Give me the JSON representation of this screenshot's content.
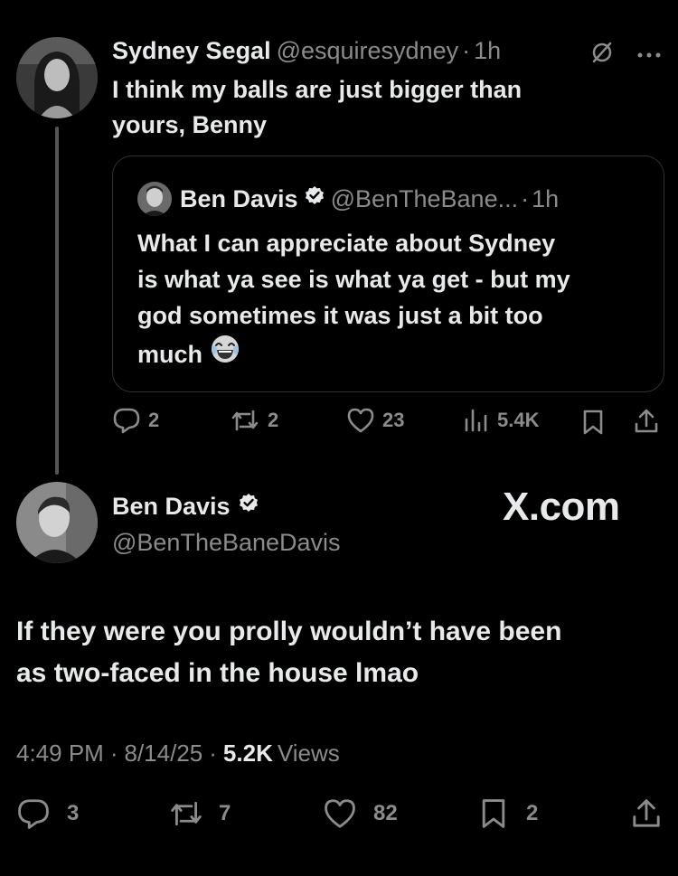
{
  "parent_post": {
    "author_name": "Sydney Segal",
    "handle": "@esquiresydney",
    "separator": "·",
    "time": "1h",
    "text_line1": "I think my balls are just bigger than",
    "text_line2": "yours, Benny",
    "quote": {
      "author_name": "Ben Davis",
      "handle": "@BenTheBane...",
      "separator": "·",
      "time": "1h",
      "text_line1": "What I can appreciate about Sydney",
      "text_line2": "is what ya see is what ya get - but my",
      "text_line3": "god sometimes it was just a bit too",
      "text_line4": "much",
      "emoji": "😂"
    },
    "actions": {
      "replies": "2",
      "reposts": "2",
      "likes": "23",
      "views": "5.4K"
    }
  },
  "main_post": {
    "author_name": "Ben Davis",
    "handle": "@BenTheBaneDavis",
    "watermark": "X.com",
    "text_line1": "If they were you prolly wouldn’t have been",
    "text_line2": "as two-faced in the house lmao",
    "meta": {
      "time": "4:49 PM",
      "sep1": "·",
      "date": "8/14/25",
      "sep2": "·",
      "views_count": "5.2K",
      "views_label": "Views"
    },
    "actions": {
      "replies": "3",
      "reposts": "7",
      "likes": "82",
      "bookmarks": "2"
    }
  },
  "icons": {
    "grok": "grok-icon",
    "more": "more-icon",
    "verified": "verified-badge-icon",
    "reply": "reply-icon",
    "repost": "repost-icon",
    "like": "like-icon",
    "views": "views-icon",
    "bookmark": "bookmark-icon",
    "share": "share-icon"
  },
  "colors": {
    "background": "#000000",
    "text": "#e7e9ea",
    "secondary": "#8b8b8b",
    "border": "#2f3336"
  }
}
